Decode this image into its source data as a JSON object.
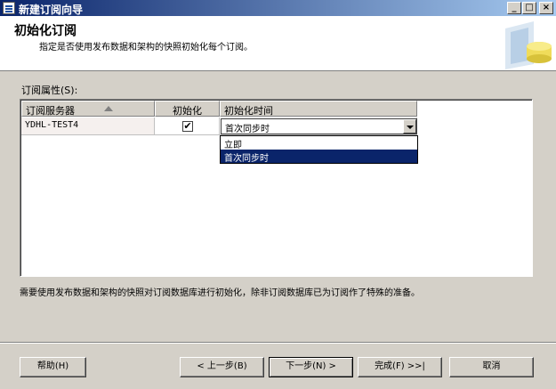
{
  "window": {
    "title": "新建订阅向导"
  },
  "header": {
    "title": "初始化订阅",
    "description": "指定是否使用发布数据和架构的快照初始化每个订阅。"
  },
  "props_label": "订阅属性(S):",
  "grid": {
    "columns": [
      "订阅服务器",
      "初始化",
      "初始化时间"
    ],
    "rows": [
      {
        "server": "YDHL-TEST4",
        "initialize": "✔",
        "init_time": "首次同步时"
      }
    ]
  },
  "dropdown": {
    "options": [
      "立即",
      "首次同步时"
    ],
    "selected": "首次同步时"
  },
  "note": "需要使用发布数据和架构的快照对订阅数据库进行初始化，除非订阅数据库已为订阅作了特殊的准备。",
  "buttons": {
    "help": "帮助(H)",
    "back": "< 上一步(B)",
    "next": "下一步(N) >",
    "finish": "完成(F) >>|",
    "cancel": "取消"
  }
}
